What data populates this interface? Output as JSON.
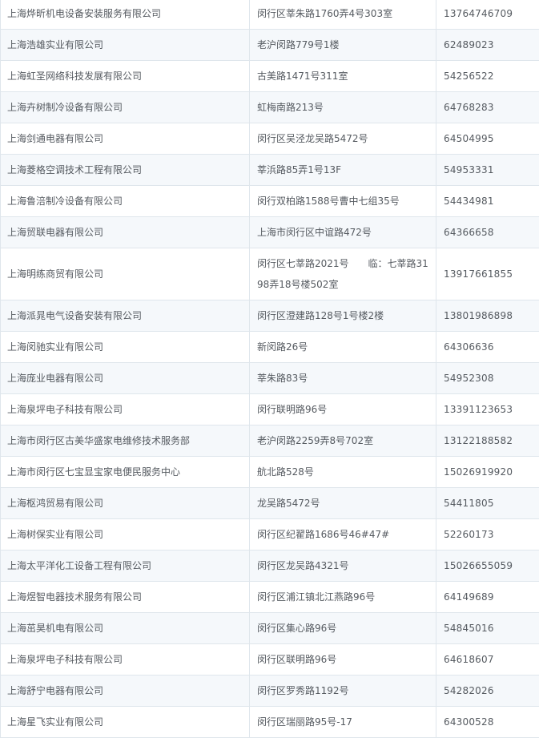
{
  "rows": [
    {
      "name": "上海烨昕机电设备安装服务有限公司",
      "address": "闵行区莘朱路1760弄4号303室",
      "phone": "13764746709"
    },
    {
      "name": "上海浩雄实业有限公司",
      "address": "老沪闵路779号1楼",
      "phone": "62489023"
    },
    {
      "name": "上海虹圣网络科技发展有限公司",
      "address": "古美路1471号311室",
      "phone": "54256522"
    },
    {
      "name": "上海卉树制冷设备有限公司",
      "address": "虹梅南路213号",
      "phone": "64768283"
    },
    {
      "name": "上海剑通电器有限公司",
      "address": "闵行区吴泾龙吴路5472号",
      "phone": "64504995"
    },
    {
      "name": "上海菱格空调技术工程有限公司",
      "address": "莘浜路85弄1号13F",
      "phone": "54953331"
    },
    {
      "name": "上海鲁涪制冷设备有限公司",
      "address": "闵行双柏路1588号曹中七组35号",
      "phone": "54434981"
    },
    {
      "name": "上海贸联电器有限公司",
      "address": "上海市闵行区中谊路472号",
      "phone": "64366658"
    },
    {
      "name": "上海明练商贸有限公司",
      "address": "闵行区七莘路2021号　　临：七莘路3198弄18号楼502室",
      "phone": "13917661855"
    },
    {
      "name": "上海派晁电气设备安装有限公司",
      "address": "闵行区澄建路128号1号楼2楼",
      "phone": "13801986898"
    },
    {
      "name": "上海闵驰实业有限公司",
      "address": "新闵路26号",
      "phone": "64306636"
    },
    {
      "name": "上海庞业电器有限公司",
      "address": "莘朱路83号",
      "phone": "54952308"
    },
    {
      "name": "上海泉坪电子科技有限公司",
      "address": "闵行联明路96号",
      "phone": "13391123653"
    },
    {
      "name": "上海市闵行区古美华盛家电维修技术服务部",
      "address": "老沪闵路2259弄8号702室",
      "phone": "13122188582"
    },
    {
      "name": "上海市闵行区七宝显宝家电便民服务中心",
      "address": "航北路528号",
      "phone": "15026919920"
    },
    {
      "name": "上海枢鸿贸易有限公司",
      "address": "龙吴路5472号",
      "phone": "54411805"
    },
    {
      "name": "上海树保实业有限公司",
      "address": "闵行区纪翟路1686号46#47#",
      "phone": "52260173"
    },
    {
      "name": "上海太平洋化工设备工程有限公司",
      "address": "闵行区龙吴路4321号",
      "phone": "15026655059"
    },
    {
      "name": "上海煜智电器技术服务有限公司",
      "address": "闵行区浦江镇北江燕路96号",
      "phone": "64149689"
    },
    {
      "name": "上海茁昊机电有限公司",
      "address": "闵行区集心路96号",
      "phone": "54845016"
    },
    {
      "name": "上海泉坪电子科技有限公司",
      "address": "闵行区联明路96号",
      "phone": "64618607"
    },
    {
      "name": "上海舒宁电器有限公司",
      "address": "闵行区罗秀路1192号",
      "phone": "54282026"
    },
    {
      "name": "上海星飞实业有限公司",
      "address": "闵行区瑞丽路95号-17",
      "phone": "64300528"
    }
  ]
}
